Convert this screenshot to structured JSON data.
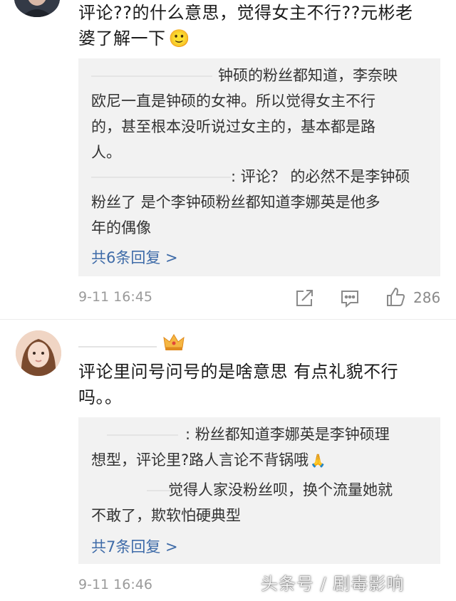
{
  "comment1": {
    "text_line1": "评论??的什么意思，觉得女主不行??元彬老",
    "text_line2": "婆了解一下",
    "emoji": "🙂",
    "replies": {
      "r1_l1": "钟硕的粉丝都知道，李奈映",
      "r1_l2": "欧尼一直是钟硕的女神。所以觉得女主不行",
      "r1_l3": "的，甚至根本没听说过女主的，基本都是路",
      "r1_l4": "人。",
      "r2_l1": ": 评论？ 的必然不是李钟硕",
      "r2_l2": "粉丝了 是个李钟硕粉丝都知道李娜英是他多",
      "r2_l3": "年的偶像",
      "more": "共6条回复 >"
    },
    "time": "9-11 16:45",
    "likes": "286"
  },
  "comment2": {
    "text_line1": "评论里问号问号的是啥意思 有点礼貌不行",
    "text_line2": "吗。。",
    "badge_icon": "crown-icon",
    "replies": {
      "r1_l1": ": 粉丝都知道李娜英是李钟硕理",
      "r1_l2": "想型，评论里?路人言论不背锅哦",
      "r1_emoji": "🙏",
      "r2_l1": "觉得人家没粉丝呗，换个流量她就",
      "r2_l2": "不敢了，欺软怕硬典型",
      "more": "共7条回复 >"
    },
    "time": "9-11 16:46"
  },
  "watermark": "头条号 / 剧毒影响",
  "colors": {
    "link": "#3e6ba8",
    "reply_bg": "#f2f2f2",
    "meta": "#9a9a9a"
  }
}
